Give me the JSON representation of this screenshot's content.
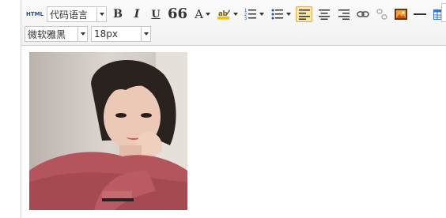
{
  "toolbar": {
    "html_label": "HTML",
    "code_language": "代码语言",
    "bold_label": "B",
    "italic_label": "I",
    "underline_label": "U",
    "blockquote_label": "66",
    "font_color_label": "A",
    "font_family": "微软雅黑",
    "font_size": "18px"
  },
  "colors": {
    "active_bg": "#ffe69f",
    "html_blue": "#1a4fa0"
  },
  "content": {
    "image": "portrait-photo"
  }
}
